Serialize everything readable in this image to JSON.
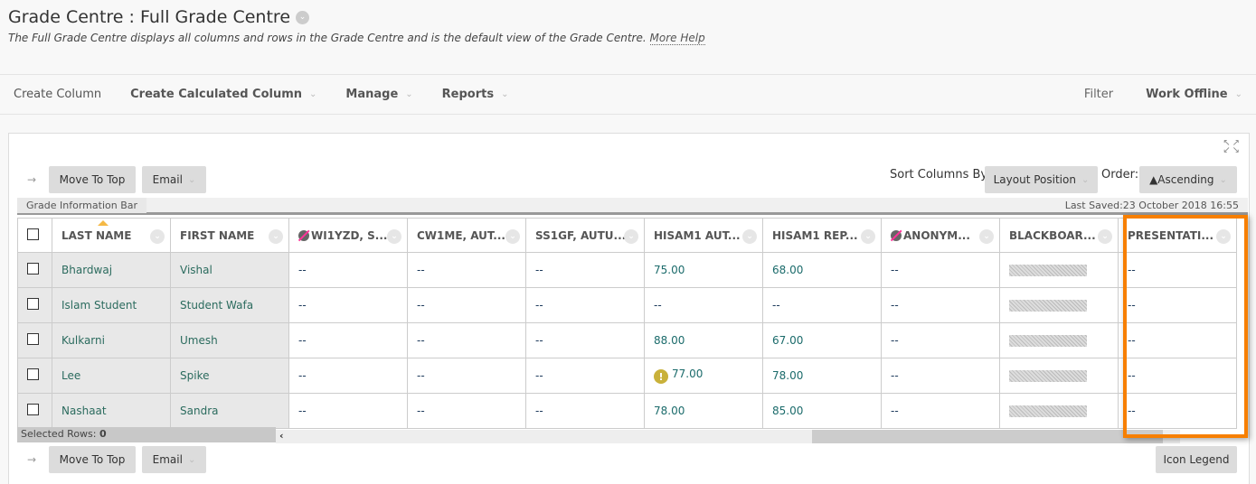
{
  "page": {
    "title": "Grade Centre : Full Grade Centre",
    "description": "The Full Grade Centre displays all columns and rows in the Grade Centre and is the default view of the Grade Centre.",
    "more_help": "More Help"
  },
  "actionbar": {
    "create_column": "Create Column",
    "create_calculated_column": "Create Calculated Column",
    "manage": "Manage",
    "reports": "Reports",
    "filter": "Filter",
    "work_offline": "Work Offline"
  },
  "toolbar": {
    "move_to_top": "Move To Top",
    "email": "Email",
    "sort_columns_by_label": "Sort Columns By:",
    "sort_columns_by_value": "Layout Position",
    "order_label": "Order:",
    "order_value": "▲Ascending",
    "icon_legend": "Icon Legend"
  },
  "infobar": {
    "label": "Grade Information Bar",
    "last_saved": "Last Saved:23 October 2018 16:55"
  },
  "table": {
    "headers": [
      "LAST NAME",
      "FIRST NAME",
      "WI1YZD, S...",
      "CW1ME, AUT...",
      "SS1GF, AUTU...",
      "HISAM1 AUT...",
      "HISAM1 REP...",
      "ANONYM...",
      "BLACKBOAR...",
      "PRESENTATI..."
    ],
    "rows": [
      {
        "last": "Bhardwaj",
        "first": "Vishal",
        "c1": "--",
        "c2": "--",
        "c3": "--",
        "c4": "75.00",
        "c5": "68.00",
        "c6": "--",
        "c8": "--"
      },
      {
        "last": "Islam Student",
        "first": "Student Wafa",
        "c1": "--",
        "c2": "--",
        "c3": "--",
        "c4": "--",
        "c5": "--",
        "c6": "--",
        "c8": "--"
      },
      {
        "last": "Kulkarni",
        "first": "Umesh",
        "c1": "--",
        "c2": "--",
        "c3": "--",
        "c4": "88.00",
        "c5": "67.00",
        "c6": "--",
        "c8": "--"
      },
      {
        "last": "Lee",
        "first": "Spike",
        "c1": "--",
        "c2": "--",
        "c3": "--",
        "c4": "77.00",
        "c5": "78.00",
        "c6": "--",
        "c8": "--"
      },
      {
        "last": "Nashaat",
        "first": "Sandra",
        "c1": "--",
        "c2": "--",
        "c3": "--",
        "c4": "78.00",
        "c5": "85.00",
        "c6": "--",
        "c8": "--"
      }
    ]
  },
  "footer": {
    "selected_rows_label": "Selected Rows:",
    "selected_rows_count": "0"
  },
  "colors": {
    "highlight": "#f77f00",
    "name_text": "#2b6b5e",
    "score_text": "#1b6b6b"
  }
}
